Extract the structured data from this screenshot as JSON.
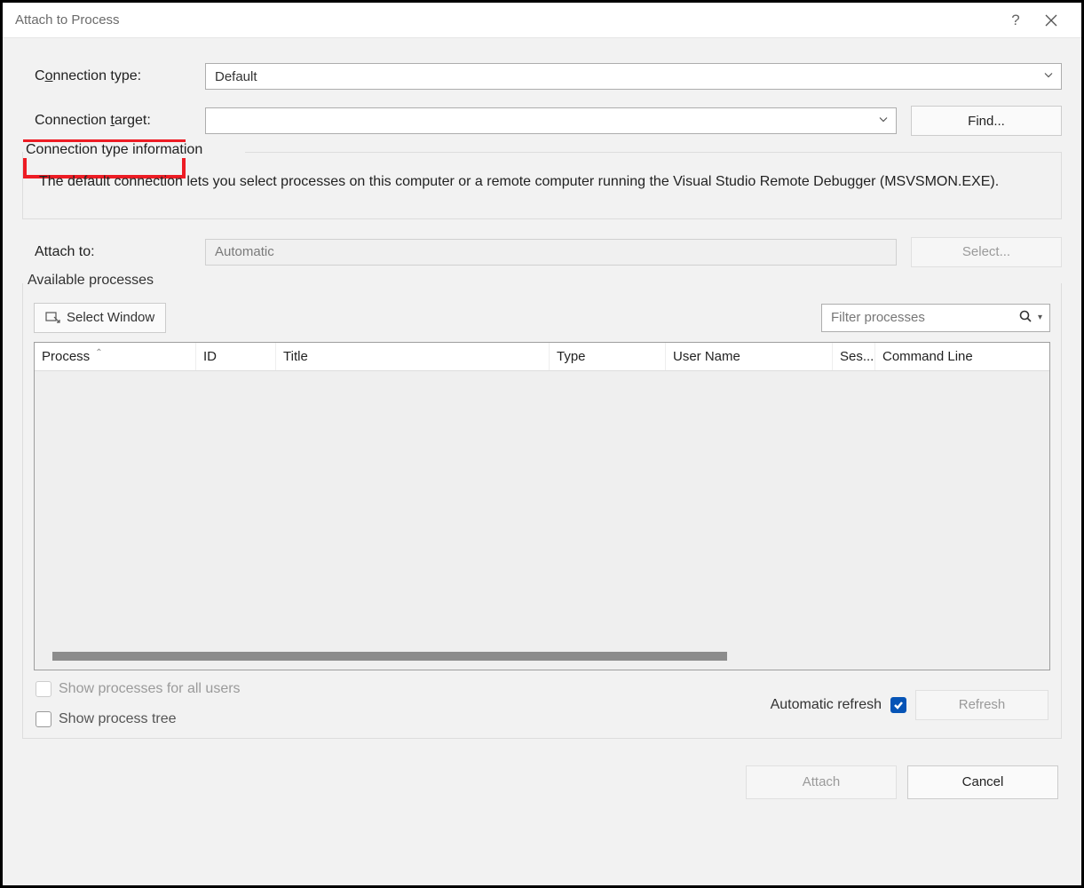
{
  "window": {
    "title": "Attach to Process"
  },
  "labels": {
    "connection_type_pre": "C",
    "connection_type_u": "o",
    "connection_type_post": "nnection type:",
    "connection_target_pre": "Connection ",
    "connection_target_u": "t",
    "connection_target_post": "arget:",
    "attach_to": "Attach to:",
    "available_pre": "A",
    "available_u": "v",
    "available_post": "ailable processes",
    "connection_info_legend": "Connection type information"
  },
  "fields": {
    "connection_type_value": "Default",
    "connection_target_value": "",
    "attach_to_value": "Automatic",
    "filter_placeholder": "Filter processes"
  },
  "info_text": "The default connection lets you select processes on this computer or a remote computer running the Visual Studio Remote Debugger (MSVSMON.EXE).",
  "buttons": {
    "find_u": "F",
    "find_post": "ind...",
    "select_u": "S",
    "select_post": "elect...",
    "select_window_pre": "Select ",
    "select_window_u": "W",
    "select_window_post": "indow",
    "refresh_u": "R",
    "refresh_post": "efresh",
    "attach_u": "A",
    "attach_post": "ttach",
    "cancel": "Cancel"
  },
  "columns": {
    "process": "Process",
    "id": "ID",
    "title": "Title",
    "type": "Type",
    "user": "User Name",
    "session": "Ses...",
    "cmd": "Command Line"
  },
  "checks": {
    "show_all_pre": "Show processes for all ",
    "show_all_u": "u",
    "show_all_post": "sers",
    "show_tree_pre": "Show process tr",
    "show_tree_u": "e",
    "show_tree_post": "e",
    "auto_refresh": "Automatic refresh"
  }
}
